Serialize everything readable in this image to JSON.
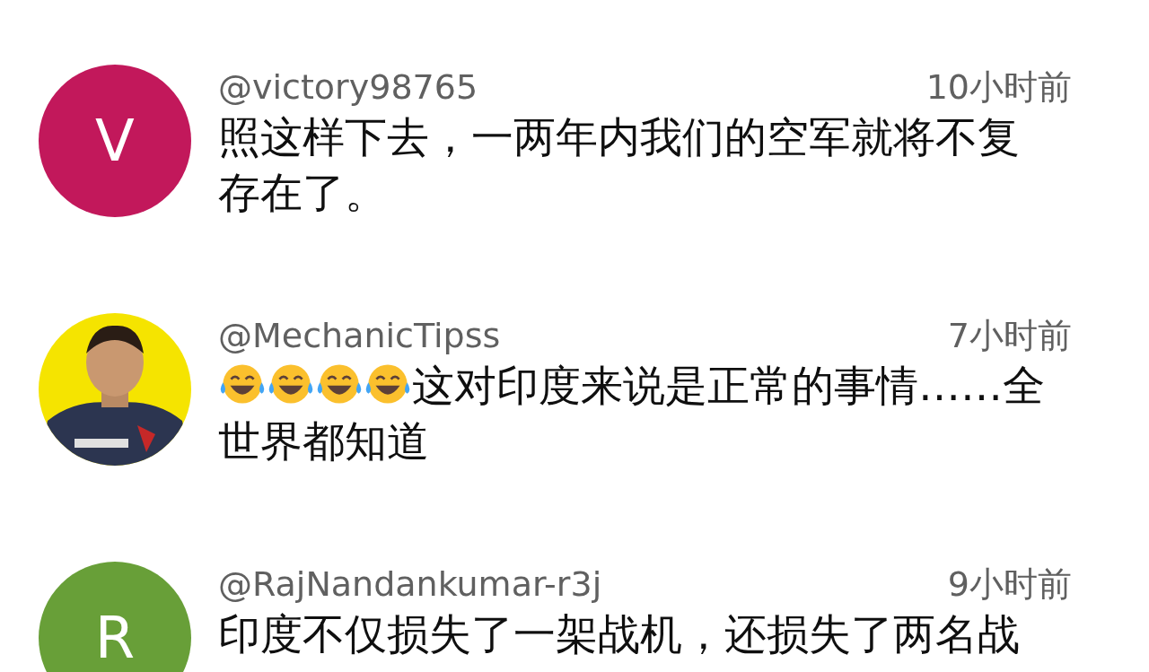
{
  "comments": [
    {
      "avatar": {
        "kind": "letter",
        "letter": "V",
        "color": "#c2185b"
      },
      "author": "@victory98765",
      "time": "10小时前",
      "text": "照这样下去，一两年内我们的空军就将不复存在了。"
    },
    {
      "author": "@MechanicTipss",
      "time": "7小时前",
      "icons": [
        {
          "kind": "laughing"
        },
        {
          "kind": "laughing"
        },
        {
          "kind": "laughing"
        },
        {
          "kind": "laughing"
        }
      ],
      "text": "这对印度来说是正常的事情……全世界都知道"
    },
    {
      "avatar": {
        "kind": "letter",
        "letter": "R",
        "color": "#689f38"
      },
      "author": "@RajNandankumar-r3j",
      "time": "9小时前",
      "text": "印度不仅损失了一架战机，还损失了两名战"
    }
  ]
}
